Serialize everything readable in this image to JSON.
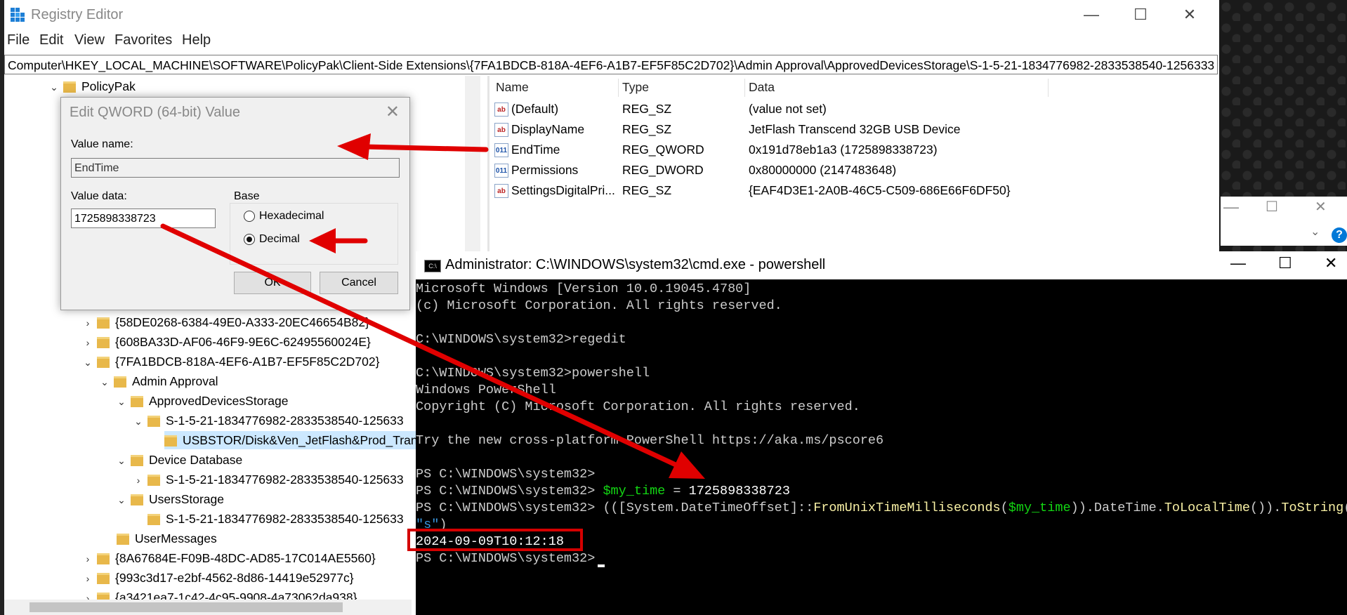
{
  "registry": {
    "title": "Registry Editor",
    "menu": [
      "File",
      "Edit",
      "View",
      "Favorites",
      "Help"
    ],
    "address": "Computer\\HKEY_LOCAL_MACHINE\\SOFTWARE\\PolicyPak\\Client-Side Extensions\\{7FA1BDCB-818A-4EF6-A1B7-EF5F85C2D702}\\Admin Approval\\ApprovedDevicesStorage\\S-1-5-21-1834776982-2833538540-1256333",
    "tree": {
      "policypak": "PolicyPak",
      "items": [
        "{58DE0268-6384-49E0-A333-20EC46654B82}",
        "{608BA33D-AF06-46F9-9E6C-62495560024E}",
        "{7FA1BDCB-818A-4EF6-A1B7-EF5F85C2D702}",
        "Admin Approval",
        "ApprovedDevicesStorage",
        "S-1-5-21-1834776982-2833538540-125633",
        "USBSTOR/Disk&Ven_JetFlash&Prod_Trans",
        "Device Database",
        "S-1-5-21-1834776982-2833538540-125633",
        "UsersStorage",
        "S-1-5-21-1834776982-2833538540-125633",
        "UserMessages",
        "{8A67684E-F09B-48DC-AD85-17C014AE5560}",
        "{993c3d17-e2bf-4562-8d86-14419e52977c}",
        "{a3421ea7-1c42-4c95-9908-4a73062da938}"
      ]
    },
    "columns": {
      "name": "Name",
      "type": "Type",
      "data": "Data"
    },
    "values": [
      {
        "name": "(Default)",
        "type": "REG_SZ",
        "data": "(value not set)",
        "icon": "ab"
      },
      {
        "name": "DisplayName",
        "type": "REG_SZ",
        "data": "JetFlash Transcend 32GB USB Device",
        "icon": "ab"
      },
      {
        "name": "EndTime",
        "type": "REG_QWORD",
        "data": "0x191d78eb1a3 (1725898338723)",
        "icon": "bin"
      },
      {
        "name": "Permissions",
        "type": "REG_DWORD",
        "data": "0x80000000 (2147483648)",
        "icon": "bin"
      },
      {
        "name": "SettingsDigitalPri...",
        "type": "REG_SZ",
        "data": "{EAF4D3E1-2A0B-46C5-C509-686E66F6DF50}",
        "icon": "ab"
      }
    ]
  },
  "dialog": {
    "title": "Edit QWORD (64-bit) Value",
    "value_name_label": "Value name:",
    "value_name": "EndTime",
    "value_data_label": "Value data:",
    "value_data": "1725898338723",
    "base_label": "Base",
    "hex_label": "Hexadecimal",
    "dec_label": "Decimal",
    "selected_base": "Decimal",
    "ok": "OK",
    "cancel": "Cancel"
  },
  "cmd": {
    "title": "Administrator: C:\\WINDOWS\\system32\\cmd.exe - powershell",
    "lines": {
      "l1": "Microsoft Windows [Version 10.0.19045.4780]",
      "l2": "(c) Microsoft Corporation. All rights reserved.",
      "l3": "C:\\WINDOWS\\system32>regedit",
      "l4": "C:\\WINDOWS\\system32>powershell",
      "l5": "Windows PowerShell",
      "l6": "Copyright (C) Microsoft Corporation. All rights reserved.",
      "l7": "Try the new cross-platform PowerShell https://aka.ms/pscore6",
      "ps_prompt": "PS C:\\WINDOWS\\system32>",
      "var": "$my_time",
      "eq": " = ",
      "num": "1725898338723",
      "cmd_a": " (([System.DateTimeOffset]::",
      "cmd_b": "FromUnixTimeMilliseconds",
      "cmd_c": "(",
      "cmd_d": ")).DateTime.",
      "cmd_e": "ToLocalTime",
      "cmd_f": "()).",
      "cmd_g": "ToString",
      "cmd_h": "(",
      "cmd_str": "\"s\"",
      "cmd_close": ")",
      "result": "2024-09-09T10:12:18"
    }
  },
  "colors": {
    "arrow": "#e00000",
    "highlight": "#d40000",
    "accent": "#0078d7"
  }
}
